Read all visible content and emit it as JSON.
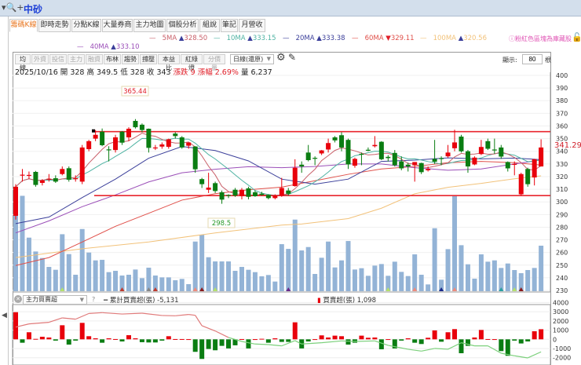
{
  "topbar": {
    "search_icon": "search-plus-icon",
    "stock_name": "中砂"
  },
  "tabs": [
    "籌碼K線",
    "即時走勢",
    "分點K線",
    "大量券商",
    "主力地圖",
    "個股分析",
    "組說",
    "筆記",
    "月營收"
  ],
  "ma_legend": [
    {
      "label": "5MA",
      "arrow": "▲",
      "value": "328.50",
      "color": "#c9606a"
    },
    {
      "label": "10MA",
      "arrow": "▲",
      "value": "333.15",
      "color": "#4fb3a3"
    },
    {
      "label": "20MA",
      "arrow": "▲",
      "value": "333.38",
      "color": "#3b3f9a"
    },
    {
      "label": "60MA",
      "arrow": "▼",
      "value": "329.11",
      "color": "#e0504a"
    },
    {
      "label": "100MA",
      "arrow": "▲",
      "value": "320.56",
      "color": "#f2c27a"
    },
    {
      "label": "40MA",
      "arrow": "▲",
      "value": "333.10",
      "color": "#9b4fb8"
    }
  ],
  "note": "ⓘ粉紅色區塊為庫藏股",
  "toolbar": {
    "items": [
      {
        "label": "均線",
        "dim": false
      },
      {
        "label": "外資",
        "dim": true
      },
      {
        "label": "投信",
        "dim": true
      },
      {
        "label": "主力",
        "dim": true
      },
      {
        "label": "融資",
        "dim": true
      },
      {
        "label": "布林",
        "dim": false
      },
      {
        "label": "趨勢",
        "dim": false
      },
      {
        "label": "撐壓",
        "dim": false
      },
      {
        "label": "本益比",
        "dim": false
      },
      {
        "label": "紅綠燈",
        "dim": false
      },
      {
        "label": "分價量",
        "dim": true
      }
    ],
    "period": "日線(還原)",
    "show_label": "顯示:",
    "show_value": "80",
    "show_unit": "根"
  },
  "info": {
    "date": "2025/10/16",
    "open": "開 328",
    "high": "高 349.5",
    "low": "低 328",
    "close": "收 343",
    "change": "漲跌 9",
    "pct": "漲幅 2.69%",
    "volume": "量 6,237"
  },
  "chart_data": {
    "type": "candlestick",
    "ylim": [
      230,
      400
    ],
    "yticks": [
      230,
      240,
      250,
      260,
      270,
      280,
      290,
      300,
      310,
      320,
      330,
      340,
      350,
      360,
      370,
      380,
      390,
      400
    ],
    "last_price_label": "341.29",
    "high_label": "365.44",
    "low_label": "298.5",
    "support_resistance": [
      355.5,
      305
    ],
    "colors": {
      "up": "#e8000b",
      "down": "#0a7d12",
      "volume": "#93b3d6"
    },
    "candles": [
      [
        289,
        314,
        286,
        312
      ],
      [
        321,
        326,
        316,
        321.5
      ],
      [
        321,
        324,
        318,
        321.3
      ],
      [
        323.7,
        324.5,
        312,
        313.4
      ],
      [
        315,
        318,
        313,
        317
      ],
      [
        318,
        322,
        316,
        318.3
      ],
      [
        318.7,
        321,
        315,
        316
      ],
      [
        322,
        328,
        321,
        326
      ],
      [
        326.6,
        328,
        316,
        317.5
      ],
      [
        318.5,
        321,
        316,
        318.7
      ],
      [
        316,
        345,
        314,
        343
      ],
      [
        341.7,
        349,
        340,
        348
      ],
      [
        350,
        356.8,
        348,
        353
      ],
      [
        355.5,
        358,
        344,
        344.8
      ],
      [
        341.5,
        344,
        332,
        341
      ],
      [
        341,
        353,
        339,
        351
      ],
      [
        355.5,
        356,
        345,
        346.8
      ],
      [
        351,
        359,
        348,
        357.8
      ],
      [
        364,
        365.44,
        358,
        359
      ],
      [
        361,
        362,
        355,
        356.8
      ],
      [
        357.8,
        358,
        339,
        342.7
      ],
      [
        342.5,
        345,
        341,
        343
      ],
      [
        343.7,
        347,
        342,
        345.4
      ],
      [
        343.5,
        350,
        342,
        349.5
      ],
      [
        354,
        355,
        350,
        352
      ],
      [
        351,
        352,
        342,
        343
      ],
      [
        344.4,
        347,
        342,
        346.9
      ],
      [
        343.8,
        344,
        323,
        325.8
      ],
      [
        318,
        319,
        311,
        314
      ],
      [
        309.6,
        323,
        307,
        311.3
      ],
      [
        314.8,
        316,
        307,
        308.6
      ],
      [
        307.6,
        309,
        298.5,
        301.8
      ],
      [
        305.5,
        306,
        303,
        305
      ],
      [
        309.6,
        311,
        304,
        305
      ],
      [
        304.5,
        311,
        302,
        309.6
      ],
      [
        310.7,
        312,
        302,
        304
      ],
      [
        307.6,
        309,
        304,
        304.5
      ],
      [
        306.5,
        308,
        305,
        305.5
      ],
      [
        305.5,
        306,
        302,
        303
      ],
      [
        303,
        306,
        302,
        305
      ],
      [
        305,
        319,
        304,
        311
      ],
      [
        309,
        311,
        305,
        306.4
      ],
      [
        312.5,
        333.7,
        312,
        327
      ],
      [
        329.4,
        332,
        323,
        328
      ],
      [
        339,
        345,
        332,
        333
      ],
      [
        334.8,
        336,
        329,
        334.6
      ],
      [
        338.3,
        341,
        337,
        340.7
      ],
      [
        341.4,
        350,
        339,
        346.5
      ],
      [
        351,
        352,
        347,
        348.6
      ],
      [
        352.7,
        355,
        340,
        343
      ],
      [
        349,
        350,
        326,
        329.6
      ],
      [
        328.6,
        335,
        327,
        334
      ],
      [
        338,
        339,
        329,
        337.8
      ],
      [
        341.2,
        343,
        340,
        341
      ],
      [
        344,
        352,
        343,
        345
      ],
      [
        347.5,
        348,
        333,
        333.7
      ],
      [
        335.6,
        337,
        332,
        334.6
      ],
      [
        338.7,
        341,
        328,
        329
      ],
      [
        332,
        336,
        325,
        326.5
      ],
      [
        329.4,
        331,
        324,
        328
      ],
      [
        329,
        331.5,
        316,
        331.5
      ],
      [
        330.7,
        331,
        322,
        323.5
      ],
      [
        325,
        328,
        324,
        326
      ],
      [
        334,
        349,
        330,
        331.7
      ],
      [
        334.6,
        336,
        329,
        334
      ],
      [
        336,
        345,
        335,
        339
      ],
      [
        342.4,
        357,
        340,
        347
      ],
      [
        351.6,
        353,
        339,
        340
      ],
      [
        340,
        341,
        323,
        328
      ],
      [
        329.6,
        336,
        329,
        335
      ],
      [
        337.8,
        349,
        337,
        343.4
      ],
      [
        348,
        350,
        341,
        342
      ],
      [
        341.4,
        350,
        338,
        341.2
      ],
      [
        343,
        345,
        334,
        335.8
      ],
      [
        331.5,
        332,
        324,
        326.5
      ],
      [
        329.5,
        332,
        321,
        330
      ],
      [
        306,
        323,
        305,
        322
      ],
      [
        326,
        327,
        312,
        314
      ],
      [
        319.3,
        334,
        313,
        333.7
      ],
      [
        328,
        349.5,
        328,
        343
      ]
    ],
    "volumes": [
      10382,
      13067,
      7339,
      5442,
      4547,
      3329,
      2936,
      7804,
      5084,
      2255,
      8520,
      5298,
      4224,
      4296,
      2613,
      2792,
      2148,
      2255,
      2971,
      1790,
      3222,
      2148,
      1897,
      1897,
      1504,
      1683,
      967,
      6802,
      7733,
      4654,
      4081,
      4081,
      4081,
      2792,
      3329,
      2936,
      2613,
      2041,
      2220,
      1325,
      6444,
      5800,
      9809,
      5585,
      6050,
      2363,
      4582,
      6802,
      3258,
      4224,
      6874,
      2971,
      3150,
      2112,
      3508,
      3723,
      2112,
      4045,
      2649,
      2076,
      5048,
      2255,
      931,
      8628,
      1575,
      5764,
      13174,
      6301,
      3687,
      1718,
      5048,
      4045,
      4224,
      3186,
      3795,
      2900,
      2470,
      2900,
      3186,
      6237
    ],
    "ma_sampled": {
      "20MA": {
        "i": [
          0,
          5,
          10,
          15,
          20,
          25,
          30,
          35,
          40,
          45,
          50,
          55,
          60,
          65,
          70,
          75,
          79
        ],
        "v": [
          282.8,
          288,
          303.4,
          318,
          334.5,
          343.8,
          340.6,
          332.4,
          318,
          314,
          318,
          332,
          333,
          334.8,
          334,
          334.6,
          333.38
        ]
      },
      "40MA": {
        "i": [
          0,
          5,
          10,
          15,
          20,
          25,
          30,
          35,
          40,
          45,
          50,
          55,
          60,
          65,
          70,
          75,
          79
        ],
        "v": [
          275.5,
          285,
          296.2,
          305.5,
          315.8,
          323,
          325.8,
          327.8,
          327,
          328,
          330,
          330,
          327,
          325,
          326,
          330,
          333.1
        ]
      },
      "60MA": {
        "i": [
          0,
          5,
          10,
          15,
          20,
          25,
          30,
          35,
          40,
          45,
          50,
          55,
          60,
          65,
          70,
          75,
          79
        ],
        "v": [
          249.7,
          256,
          268.3,
          280.7,
          291,
          301.4,
          306.5,
          309.6,
          311.7,
          316.7,
          321.8,
          326,
          328,
          331,
          332,
          331,
          329.11
        ]
      },
      "100MA": {
        "i": [
          0,
          10,
          20,
          30,
          40,
          43,
          50,
          55,
          60,
          65,
          70,
          75,
          79
        ],
        "v": [
          256,
          263,
          268.3,
          275.5,
          281.7,
          282.5,
          286.8,
          295,
          306.4,
          311.5,
          314.6,
          318.3,
          320.56
        ]
      }
    },
    "sub": {
      "selector": "主力買賣超",
      "help": "?",
      "cum_label": "累計買賣超(張) -5,131",
      "bar_label": "買賣超(張) 1,098",
      "ylim": [
        -2500,
        4500
      ],
      "yticks": [
        -2000,
        -1000,
        0,
        1000,
        2000,
        3000,
        4000
      ],
      "bars": [
        2950,
        -370,
        770,
        50,
        280,
        200,
        -140,
        1530,
        -570,
        -140,
        1790,
        340,
        110,
        -370,
        110,
        30,
        -230,
        450,
        110,
        -310,
        -340,
        -340,
        -140,
        340,
        30,
        30,
        20,
        -1360,
        -2130,
        -1050,
        -1190,
        -710,
        -990,
        -650,
        30,
        -990,
        20,
        60,
        -370,
        110,
        -280,
        -280,
        1850,
        -990,
        -230,
        20,
        430,
        200,
        400,
        340,
        -570,
        -370,
        400,
        170,
        200,
        -1080,
        20,
        -990,
        -140,
        110,
        -370,
        -510,
        170,
        970,
        -260,
        770,
        1110,
        -1510,
        -710,
        200,
        1020,
        30,
        20,
        -1280,
        -1790,
        -140,
        -450,
        -230,
        880,
        1098
      ],
      "cum_line": {
        "i": [
          0,
          2,
          5,
          7,
          9,
          11,
          13,
          16,
          19,
          22,
          24,
          26,
          27,
          28,
          30,
          32,
          34,
          36,
          38,
          40,
          42,
          43,
          46,
          49,
          51,
          54,
          56,
          59,
          61,
          63,
          65,
          67,
          69,
          71,
          73,
          75,
          77,
          79
        ],
        "v": [
          1335,
          1680,
          1850,
          2330,
          2190,
          2810,
          2900,
          2750,
          2840,
          2590,
          2560,
          2700,
          2610,
          1480,
          910,
          200,
          -230,
          -510,
          -570,
          -710,
          -140,
          -510,
          -370,
          -170,
          -230,
          -170,
          -650,
          -1080,
          -1280,
          -990,
          -1080,
          -370,
          -710,
          -710,
          -1510,
          -1790,
          -2020,
          -1360
        ]
      }
    }
  }
}
